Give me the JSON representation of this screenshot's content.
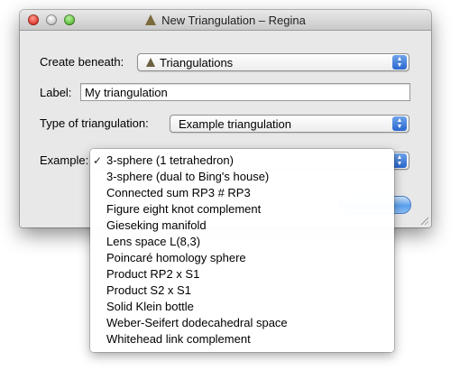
{
  "window": {
    "title": "New Triangulation – Regina"
  },
  "form": {
    "create_beneath_label": "Create beneath:",
    "create_beneath_value": "Triangulations",
    "label_label": "Label:",
    "label_value": "My triangulation",
    "type_label": "Type of triangulation:",
    "type_value": "Example triangulation",
    "example_label": "Example:"
  },
  "example_menu": {
    "selected_index": 0,
    "items": [
      "3-sphere (1 tetrahedron)",
      "3-sphere (dual to Bing's house)",
      "Connected sum RP3 # RP3",
      "Figure eight knot complement",
      "Gieseking manifold",
      "Lens space L(8,3)",
      "Poincaré homology sphere",
      "Product RP2 x S1",
      "Product S2 x S1",
      "Solid Klein bottle",
      "Weber-Seifert dodecahedral space",
      "Whitehead link complement"
    ]
  },
  "icons": {
    "app_icon": "regina-triangulation-icon",
    "packet_icon": "triangulation-packet-icon",
    "check_mark": "✓",
    "popup_arrows": "up-down-arrows-icon"
  },
  "colors": {
    "accent": "#2a67d0",
    "window_bg": "#e8e8e8"
  }
}
